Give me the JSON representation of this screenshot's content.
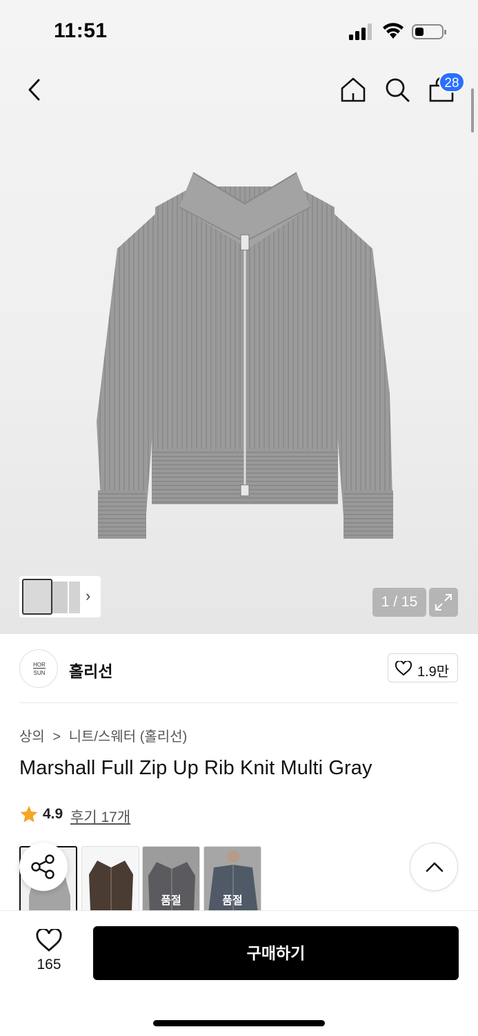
{
  "status_bar": {
    "time": "11:51"
  },
  "header": {
    "cart_badge": "28",
    "icons": [
      "back-icon",
      "home-icon",
      "search-icon",
      "bag-icon"
    ]
  },
  "gallery": {
    "counter": "1 / 15",
    "image_name": "marshall-full-zip-up-rib-knit-gray"
  },
  "brand": {
    "logo_top": "HOR",
    "logo_bottom": "SUN",
    "name": "홀리선",
    "like_count": "1.9만"
  },
  "breadcrumb": {
    "level1": "상의",
    "separator": ">",
    "level2": "니트/스웨터 (홀리선)"
  },
  "product": {
    "title": "Marshall Full Zip Up Rib Knit Multi Gray",
    "rating": "4.9",
    "reviews": "후기 17개"
  },
  "color_options": [
    {
      "name": "gray",
      "selected": true,
      "soldout": ""
    },
    {
      "name": "brown",
      "selected": false,
      "soldout": ""
    },
    {
      "name": "charcoal",
      "selected": false,
      "soldout": "품절"
    },
    {
      "name": "blue-gray",
      "selected": false,
      "soldout": "품절"
    }
  ],
  "bottom_bar": {
    "wish_count": "165",
    "buy_label": "구매하기"
  },
  "colors": {
    "accent_badge": "#2a6fff",
    "star": "#f5a623",
    "buy_button": "#000000"
  }
}
